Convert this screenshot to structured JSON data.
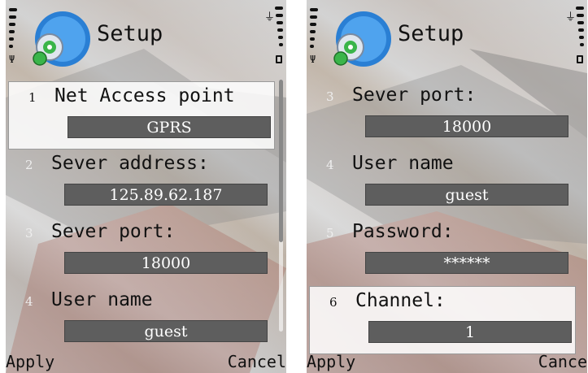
{
  "screens": [
    {
      "title": "Setup",
      "items": [
        {
          "num": "1",
          "label": "Net Access point",
          "value": "GPRS"
        },
        {
          "num": "2",
          "label": "Sever address:",
          "value": "125.89.62.187"
        },
        {
          "num": "3",
          "label": "Sever port:",
          "value": "18000"
        },
        {
          "num": "4",
          "label": "User name",
          "value": "guest"
        }
      ],
      "softkeys": {
        "left": "Apply",
        "right": "Cancel"
      }
    },
    {
      "title": "Setup",
      "items": [
        {
          "num": "3",
          "label": "Sever port:",
          "value": "18000"
        },
        {
          "num": "4",
          "label": "User name",
          "value": "guest"
        },
        {
          "num": "5",
          "label": "Password:",
          "value": "******"
        },
        {
          "num": "6",
          "label": "Channel:",
          "value": "1"
        }
      ],
      "softkeys": {
        "left": "Apply",
        "right": "Cance"
      }
    }
  ],
  "icons": {
    "logo": "globe-disc-icon",
    "signal": "signal-strength-icon",
    "antenna": "antenna-icon",
    "battery": "battery-icon",
    "charger": "plug-icon",
    "lock": "lock-icon"
  },
  "colors": {
    "field_bg": "#5e5e5e",
    "field_text": "#ffffff",
    "logo_blue": "#2a7fd4",
    "logo_green": "#3ab54a"
  }
}
